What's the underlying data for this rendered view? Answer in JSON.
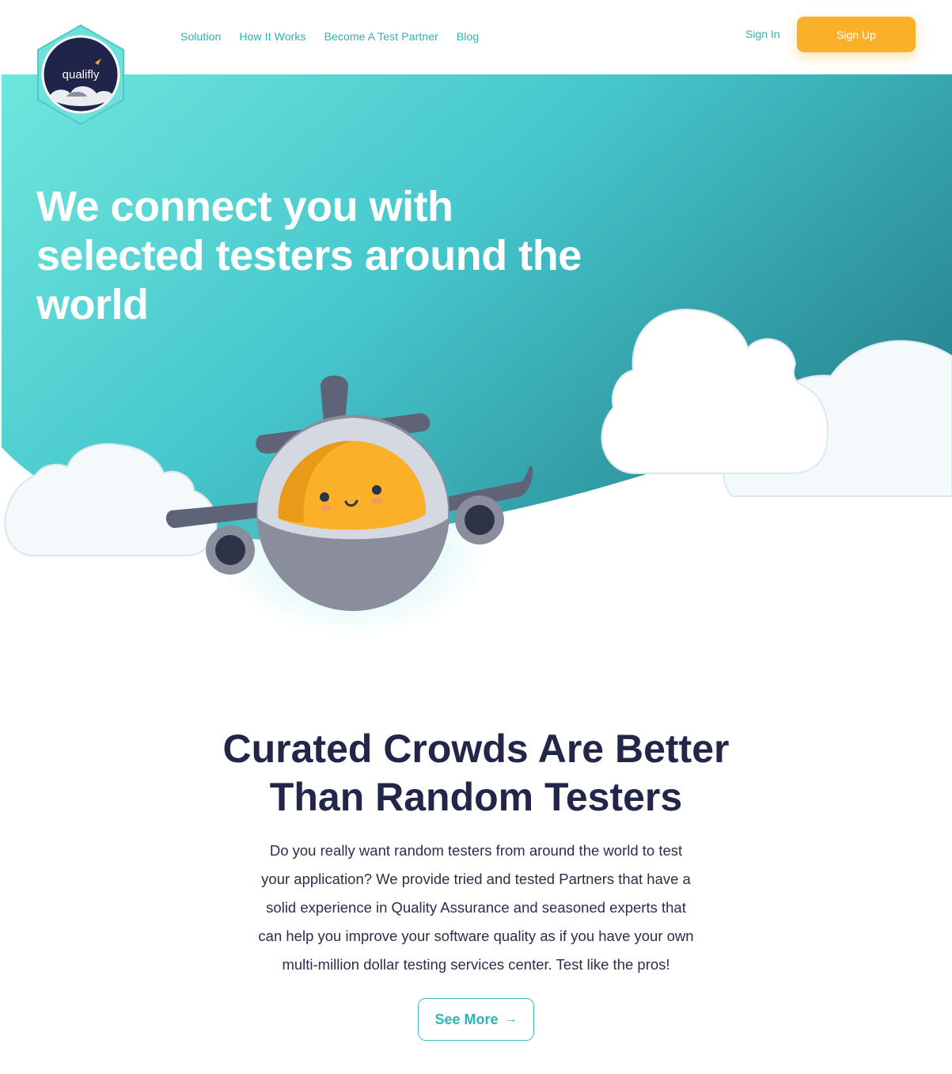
{
  "header": {
    "logo_text": "qualifly",
    "nav": [
      "Solution",
      "How It Works",
      "Become A Test Partner",
      "Blog"
    ],
    "signin_label": "Sign In",
    "signup_label": "Sign Up"
  },
  "hero": {
    "title_lines": [
      "We connect you with",
      "selected testers around the",
      "world"
    ]
  },
  "section": {
    "title_lines": [
      "Curated Crowds Are Better",
      "Than Random Testers"
    ],
    "body_lines": [
      "Do you really want random testers from around the world to test",
      "your application? We provide tried and tested Partners that have a",
      "solid experience in Quality Assurance and seasoned experts that",
      "can help you improve your software quality as if you have your own",
      "multi-million dollar testing services center. Test like the pros!"
    ],
    "see_more_label": "See More",
    "see_more_icon": "arrow-right-icon"
  },
  "colors": {
    "teal_light": "#6fe6dd",
    "teal": "#46c7cc",
    "teal_dark": "#2a8a95",
    "accent_orange": "#fab028",
    "navy": "#22274a"
  }
}
